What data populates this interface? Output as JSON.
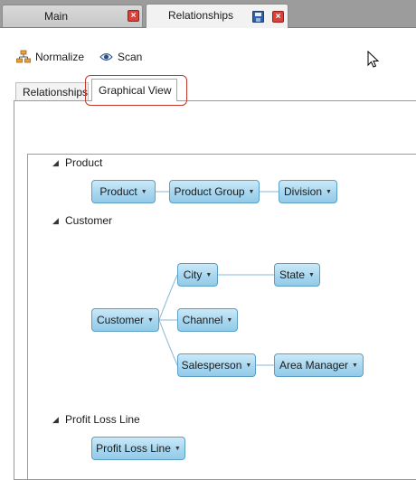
{
  "doc_tabs": [
    {
      "label": "Main"
    },
    {
      "label": "Relationships"
    }
  ],
  "toolbar": {
    "normalize_label": "Normalize",
    "scan_label": "Scan"
  },
  "view_tabs": [
    {
      "label": "Relationships"
    },
    {
      "label": "Graphical View"
    }
  ],
  "graph": {
    "groups": [
      {
        "name": "Product",
        "nodes": [
          "Product",
          "Product Group",
          "Division"
        ]
      },
      {
        "name": "Customer",
        "nodes": [
          "Customer",
          "City",
          "State",
          "Channel",
          "Salesperson",
          "Area Manager"
        ]
      },
      {
        "name": "Profit Loss Line",
        "nodes": [
          "Profit Loss Line"
        ]
      }
    ]
  },
  "colors": {
    "node_fill": "#a7d6ef",
    "node_border": "#5aa0c6",
    "highlight_border": "#c0392b",
    "close_button": "#d9423a"
  }
}
